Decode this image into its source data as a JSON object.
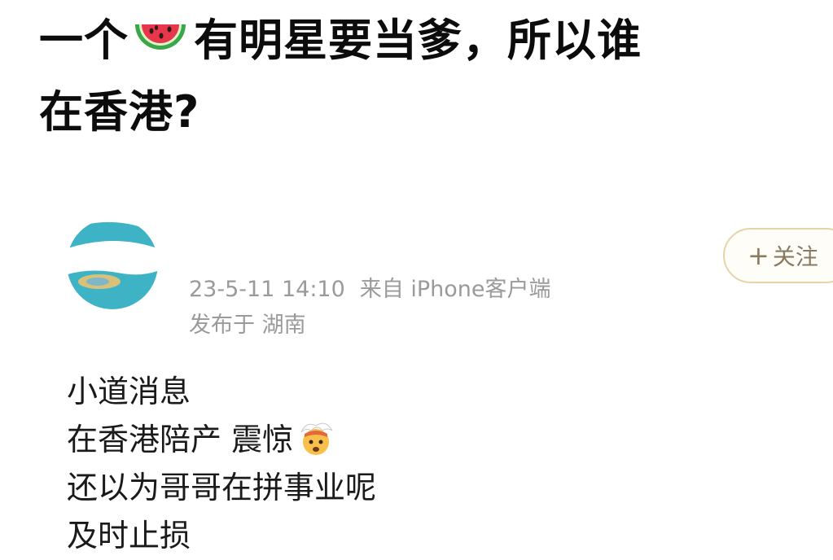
{
  "headline": {
    "line1_prefix": "一个",
    "line1_suffix": "有明星要当爹，所以谁",
    "line2": "在香港?",
    "emoji": "watermelon-icon"
  },
  "post": {
    "avatar": "avatar-image",
    "timestamp": "23-5-11 14:10",
    "source": "来自 iPhone客户端",
    "location": "发布于 湖南",
    "follow_label": "关注",
    "follow_icon": "plus-icon",
    "content": {
      "line1": "小道消息",
      "line2": "在香港陪产 震惊",
      "line2_emoji": "exploding-head-icon",
      "line3": "还以为哥哥在拼事业呢",
      "line4": "及时止损"
    }
  },
  "colors": {
    "meta_text": "#9a9a9a",
    "follow_border": "#e6d3a8",
    "follow_text": "#8a7a60",
    "avatar_teal": "#3fb3c6"
  }
}
